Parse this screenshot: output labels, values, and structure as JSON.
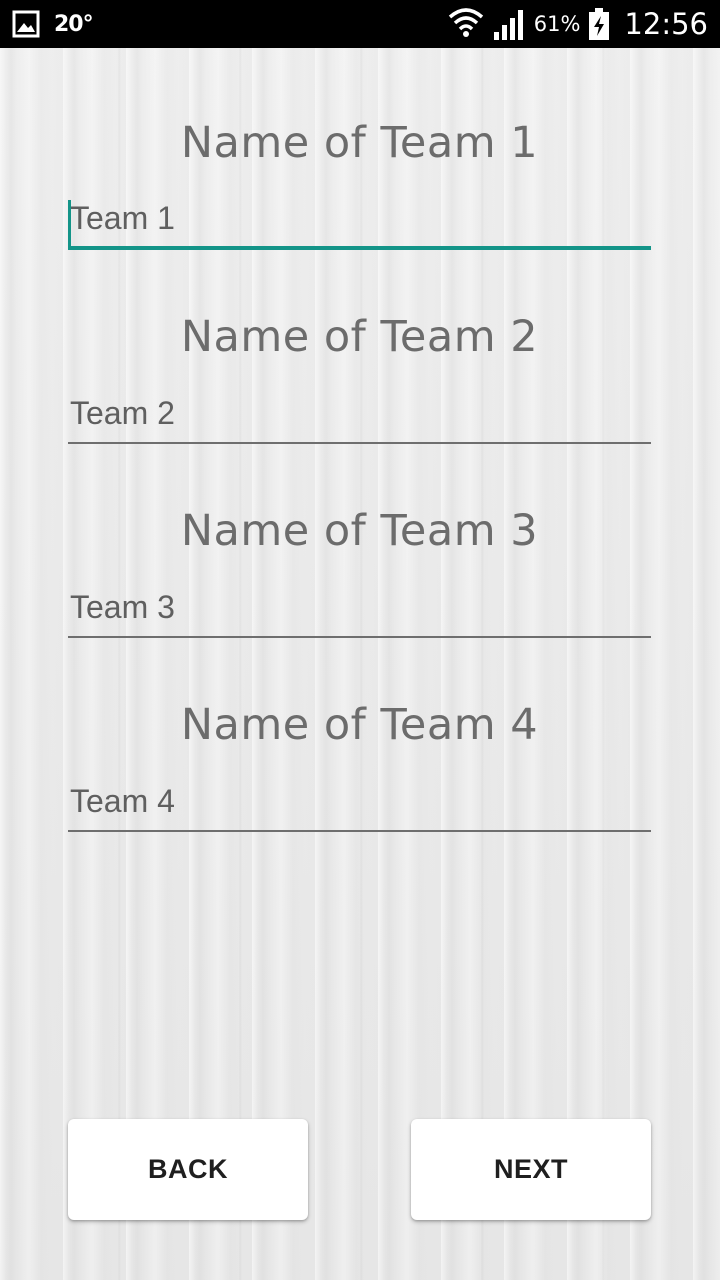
{
  "status_bar": {
    "temperature": "20°",
    "battery_percent": "61%",
    "time": "12:56",
    "icons": [
      "gallery-icon",
      "wifi-icon",
      "signal-icon",
      "battery-charging-icon"
    ]
  },
  "form": {
    "teams": [
      {
        "heading": "Name of Team 1",
        "value": "Team 1",
        "focused": true
      },
      {
        "heading": "Name of Team 2",
        "value": "Team 2",
        "focused": false
      },
      {
        "heading": "Name of Team 3",
        "value": "Team 3",
        "focused": false
      },
      {
        "heading": "Name of Team 4",
        "value": "Team 4",
        "focused": false
      }
    ]
  },
  "buttons": {
    "back_label": "BACK",
    "next_label": "NEXT"
  },
  "colors": {
    "accent": "#139488",
    "text": "#6c6c6c",
    "status_bar": "#000000",
    "button_bg": "#ffffff"
  }
}
